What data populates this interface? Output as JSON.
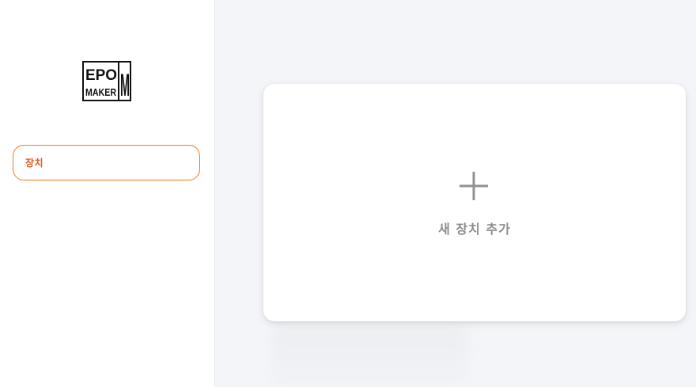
{
  "logo": {
    "brand": "EPOMAKER",
    "line1": "EPO",
    "line2": "MAKER",
    "line3": "M"
  },
  "sidebar": {
    "items": [
      {
        "label": "장치",
        "active": true
      }
    ]
  },
  "main": {
    "add_device_card": {
      "label": "새 장치 추가",
      "icon": "plus-icon"
    }
  },
  "colors": {
    "accent": "#f07a22",
    "accent_text": "#e2561a",
    "background": "#f3f5f8",
    "card": "#ffffff",
    "muted_text": "#8a8d90"
  }
}
